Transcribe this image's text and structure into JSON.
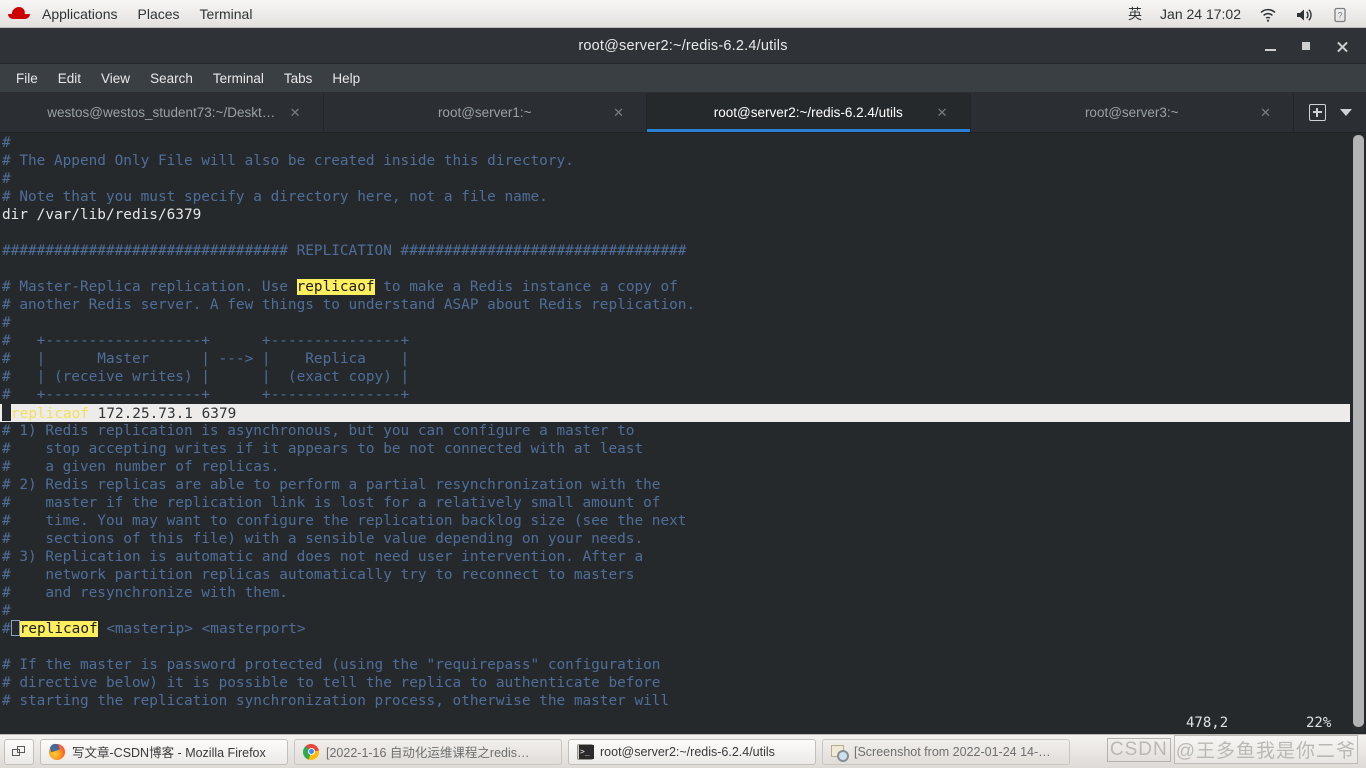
{
  "top_panel": {
    "logo": "redhat-logo",
    "menus": [
      "Applications",
      "Places",
      "Terminal"
    ],
    "input_method": "英",
    "clock": "Jan 24 17:02",
    "icons": [
      "wifi-icon",
      "volume-icon",
      "battery-icon"
    ]
  },
  "window": {
    "title": "root@server2:~/redis-6.2.4/utils",
    "controls": {
      "minimize": "–",
      "maximize": "□",
      "close": "✕"
    }
  },
  "menu_bar": [
    "File",
    "Edit",
    "View",
    "Search",
    "Terminal",
    "Tabs",
    "Help"
  ],
  "tabs": [
    {
      "label": "westos@westos_student73:~/Deskt…",
      "active": false,
      "close": "✕"
    },
    {
      "label": "root@server1:~",
      "active": false,
      "close": "✕"
    },
    {
      "label": "root@server2:~/redis-6.2.4/utils",
      "active": true,
      "close": "✕"
    },
    {
      "label": "root@server3:~",
      "active": false,
      "close": "✕"
    }
  ],
  "tab_tools": {
    "new_tab": "new-tab-icon",
    "menu": "chevron-down-icon"
  },
  "terminal": {
    "accent_highlight": "#ffef5e",
    "comment_color": "#4e6e99",
    "cursor_line_bg": "#edecea",
    "lines": [
      "#",
      "# The Append Only File will also be created inside this directory.",
      "#",
      "# Note that you must specify a directory here, not a file name.",
      "dir /var/lib/redis/6379",
      "",
      "################################# REPLICATION #################################",
      "",
      "# Master-Replica replication. Use replicaof to make a Redis instance a copy of",
      "# another Redis server. A few things to understand ASAP about Redis replication.",
      "#",
      "#   +------------------+      +---------------+",
      "#   |      Master      | ---> |    Replica    |",
      "#   | (receive writes) |      |  (exact copy) |",
      "#   +------------------+      +---------------+",
      "replicaof 172.25.73.1 6379",
      "# 1) Redis replication is asynchronous, but you can configure a master to",
      "#    stop accepting writes if it appears to be not connected with at least",
      "#    a given number of replicas.",
      "# 2) Redis replicas are able to perform a partial resynchronization with the",
      "#    master if the replication link is lost for a relatively small amount of",
      "#    time. You may want to configure the replication backlog size (see the next",
      "#    sections of this file) with a sensible value depending on your needs.",
      "# 3) Replication is automatic and does not need user intervention. After a",
      "#    network partition replicas automatically try to reconnect to masters",
      "#    and resynchronize with them.",
      "#",
      "# replicaof <masterip> <masterport>",
      "",
      "# If the master is password protected (using the \"requirepass\" configuration",
      "# directive below) it is possible to tell the replica to authenticate before",
      "# starting the replication synchronization process, otherwise the master will"
    ],
    "highlight_word": "replicaof",
    "cursor_line_command": "replicaof",
    "cursor_line_value": "172.25.73.1 6379",
    "status": {
      "position": "478,2",
      "percent": "22%"
    }
  },
  "taskbar": {
    "show_desktop": "show-desktop-icon",
    "items": [
      {
        "label": "写文章-CSDN博客 - Mozilla Firefox",
        "icon": "firefox-icon",
        "active": true
      },
      {
        "label": "[2022-1-16 自动化运维课程之redis…",
        "icon": "chrome-icon",
        "active": false
      },
      {
        "label": "root@server2:~/redis-6.2.4/utils",
        "icon": "terminal-icon",
        "active": true
      },
      {
        "label": "[Screenshot from 2022-01-24 14-…",
        "icon": "image-viewer-icon",
        "active": false
      }
    ],
    "watermark": {
      "brand": "CSDN",
      "user": "@王多鱼我是你二爷"
    }
  }
}
